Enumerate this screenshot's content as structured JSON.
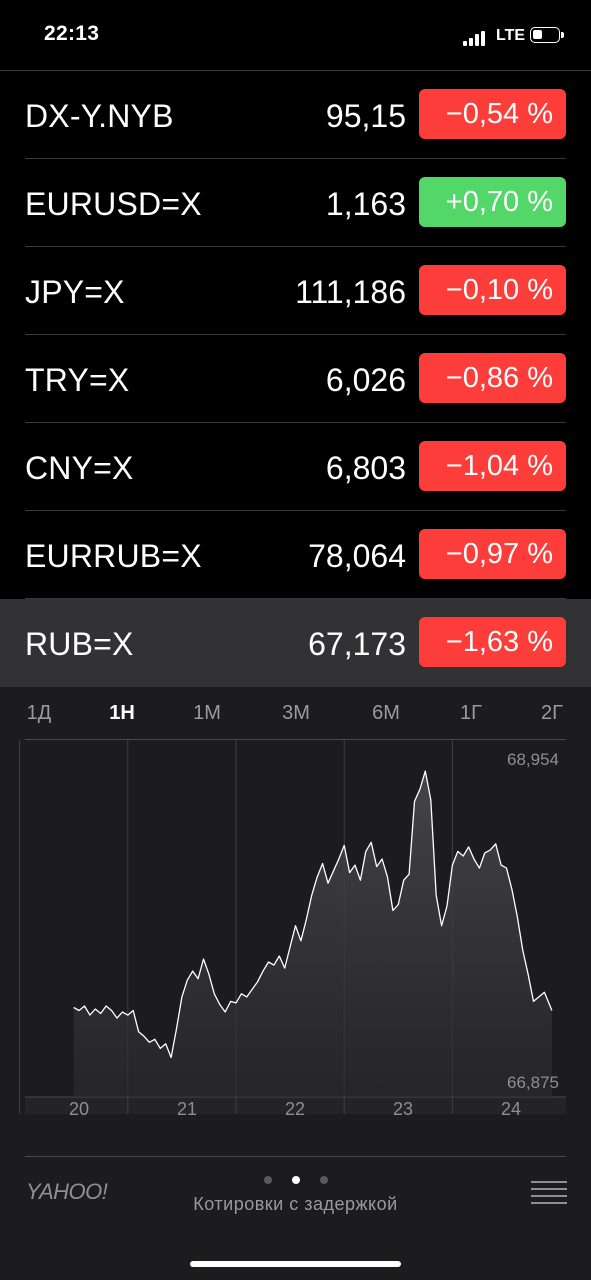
{
  "status": {
    "time": "22:13",
    "network": "LTE"
  },
  "stocks": [
    {
      "symbol": "DX-Y.NYB",
      "price": "95,15",
      "change": "−0,54 %",
      "direction": "down"
    },
    {
      "symbol": "EURUSD=X",
      "price": "1,163",
      "change": "+0,70 %",
      "direction": "up"
    },
    {
      "symbol": "JPY=X",
      "price": "111,186",
      "change": "−0,10 %",
      "direction": "down"
    },
    {
      "symbol": "TRY=X",
      "price": "6,026",
      "change": "−0,86 %",
      "direction": "down"
    },
    {
      "symbol": "CNY=X",
      "price": "6,803",
      "change": "−1,04 %",
      "direction": "down"
    },
    {
      "symbol": "EURRUB=X",
      "price": "78,064",
      "change": "−0,97 %",
      "direction": "down"
    },
    {
      "symbol": "RUB=X",
      "price": "67,173",
      "change": "−1,63 %",
      "direction": "down",
      "selected": true
    }
  ],
  "range_tabs": [
    {
      "label": "1Д"
    },
    {
      "label": "1Н",
      "active": true
    },
    {
      "label": "1М"
    },
    {
      "label": "3М"
    },
    {
      "label": "6М"
    },
    {
      "label": "1Г"
    },
    {
      "label": "2Г"
    }
  ],
  "chart_data": {
    "type": "line",
    "symbol": "RUB=X",
    "y_high_label": "68,954",
    "y_low_label": "66,875",
    "ylim": [
      66.875,
      68.954
    ],
    "x_tick_labels": [
      "20",
      "21",
      "22",
      "23",
      "24"
    ],
    "x": [
      20.0,
      20.05,
      20.1,
      20.15,
      20.2,
      20.25,
      20.3,
      20.35,
      20.4,
      20.45,
      20.5,
      20.55,
      20.6,
      20.65,
      20.7,
      20.75,
      20.8,
      20.85,
      20.9,
      20.95,
      21.0,
      21.05,
      21.1,
      21.15,
      21.2,
      21.25,
      21.3,
      21.35,
      21.4,
      21.45,
      21.5,
      21.55,
      21.6,
      21.65,
      21.7,
      21.75,
      21.8,
      21.85,
      21.9,
      21.95,
      22.0,
      22.05,
      22.1,
      22.15,
      22.2,
      22.25,
      22.3,
      22.35,
      22.4,
      22.45,
      22.5,
      22.55,
      22.6,
      22.65,
      22.7,
      22.75,
      22.8,
      22.85,
      22.9,
      22.95,
      23.0,
      23.05,
      23.1,
      23.15,
      23.2,
      23.25,
      23.3,
      23.35,
      23.4,
      23.45,
      23.5,
      23.55,
      23.6,
      23.65,
      23.7,
      23.75,
      23.8,
      23.85,
      23.9,
      23.95,
      24.0,
      24.05,
      24.1,
      24.15,
      24.2,
      24.25,
      24.35,
      24.42
    ],
    "y": [
      67.38,
      67.36,
      67.39,
      67.33,
      67.37,
      67.34,
      67.39,
      67.36,
      67.31,
      67.35,
      67.33,
      67.36,
      67.22,
      67.19,
      67.15,
      67.17,
      67.11,
      67.14,
      67.05,
      67.24,
      67.45,
      67.56,
      67.62,
      67.57,
      67.7,
      67.6,
      67.47,
      67.4,
      67.35,
      67.42,
      67.41,
      67.47,
      67.45,
      67.5,
      67.55,
      67.62,
      67.68,
      67.66,
      67.72,
      67.64,
      67.78,
      67.92,
      67.82,
      67.96,
      68.12,
      68.24,
      68.33,
      68.2,
      68.28,
      68.36,
      68.45,
      68.27,
      68.32,
      68.22,
      68.41,
      68.47,
      68.31,
      68.36,
      68.24,
      68.02,
      68.06,
      68.22,
      68.26,
      68.74,
      68.82,
      68.94,
      68.75,
      68.12,
      67.92,
      68.05,
      68.32,
      68.41,
      68.38,
      68.44,
      68.36,
      68.3,
      68.4,
      68.42,
      68.46,
      68.32,
      68.3,
      68.16,
      67.98,
      67.76,
      67.6,
      67.42,
      67.48,
      67.36
    ]
  },
  "footer": {
    "provider": "YAHOO!",
    "note": "Котировки с задержкой",
    "page_count": 3,
    "current_page": 2
  },
  "colors": {
    "negative": "#fc3d39",
    "positive": "#53d769",
    "selected_row": "#323234",
    "panel": "#1c1c1e"
  }
}
